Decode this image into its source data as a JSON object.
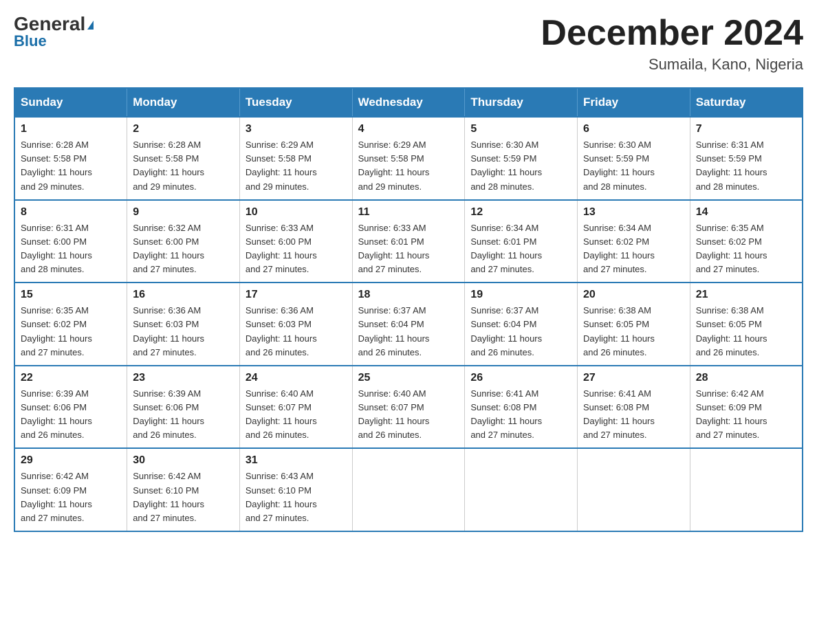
{
  "logo": {
    "part1": "General",
    "part2": "Blue"
  },
  "title": "December 2024",
  "location": "Sumaila, Kano, Nigeria",
  "days_of_week": [
    "Sunday",
    "Monday",
    "Tuesday",
    "Wednesday",
    "Thursday",
    "Friday",
    "Saturday"
  ],
  "weeks": [
    [
      {
        "day": "1",
        "sunrise": "6:28 AM",
        "sunset": "5:58 PM",
        "daylight": "11 hours and 29 minutes."
      },
      {
        "day": "2",
        "sunrise": "6:28 AM",
        "sunset": "5:58 PM",
        "daylight": "11 hours and 29 minutes."
      },
      {
        "day": "3",
        "sunrise": "6:29 AM",
        "sunset": "5:58 PM",
        "daylight": "11 hours and 29 minutes."
      },
      {
        "day": "4",
        "sunrise": "6:29 AM",
        "sunset": "5:58 PM",
        "daylight": "11 hours and 29 minutes."
      },
      {
        "day": "5",
        "sunrise": "6:30 AM",
        "sunset": "5:59 PM",
        "daylight": "11 hours and 28 minutes."
      },
      {
        "day": "6",
        "sunrise": "6:30 AM",
        "sunset": "5:59 PM",
        "daylight": "11 hours and 28 minutes."
      },
      {
        "day": "7",
        "sunrise": "6:31 AM",
        "sunset": "5:59 PM",
        "daylight": "11 hours and 28 minutes."
      }
    ],
    [
      {
        "day": "8",
        "sunrise": "6:31 AM",
        "sunset": "6:00 PM",
        "daylight": "11 hours and 28 minutes."
      },
      {
        "day": "9",
        "sunrise": "6:32 AM",
        "sunset": "6:00 PM",
        "daylight": "11 hours and 27 minutes."
      },
      {
        "day": "10",
        "sunrise": "6:33 AM",
        "sunset": "6:00 PM",
        "daylight": "11 hours and 27 minutes."
      },
      {
        "day": "11",
        "sunrise": "6:33 AM",
        "sunset": "6:01 PM",
        "daylight": "11 hours and 27 minutes."
      },
      {
        "day": "12",
        "sunrise": "6:34 AM",
        "sunset": "6:01 PM",
        "daylight": "11 hours and 27 minutes."
      },
      {
        "day": "13",
        "sunrise": "6:34 AM",
        "sunset": "6:02 PM",
        "daylight": "11 hours and 27 minutes."
      },
      {
        "day": "14",
        "sunrise": "6:35 AM",
        "sunset": "6:02 PM",
        "daylight": "11 hours and 27 minutes."
      }
    ],
    [
      {
        "day": "15",
        "sunrise": "6:35 AM",
        "sunset": "6:02 PM",
        "daylight": "11 hours and 27 minutes."
      },
      {
        "day": "16",
        "sunrise": "6:36 AM",
        "sunset": "6:03 PM",
        "daylight": "11 hours and 27 minutes."
      },
      {
        "day": "17",
        "sunrise": "6:36 AM",
        "sunset": "6:03 PM",
        "daylight": "11 hours and 26 minutes."
      },
      {
        "day": "18",
        "sunrise": "6:37 AM",
        "sunset": "6:04 PM",
        "daylight": "11 hours and 26 minutes."
      },
      {
        "day": "19",
        "sunrise": "6:37 AM",
        "sunset": "6:04 PM",
        "daylight": "11 hours and 26 minutes."
      },
      {
        "day": "20",
        "sunrise": "6:38 AM",
        "sunset": "6:05 PM",
        "daylight": "11 hours and 26 minutes."
      },
      {
        "day": "21",
        "sunrise": "6:38 AM",
        "sunset": "6:05 PM",
        "daylight": "11 hours and 26 minutes."
      }
    ],
    [
      {
        "day": "22",
        "sunrise": "6:39 AM",
        "sunset": "6:06 PM",
        "daylight": "11 hours and 26 minutes."
      },
      {
        "day": "23",
        "sunrise": "6:39 AM",
        "sunset": "6:06 PM",
        "daylight": "11 hours and 26 minutes."
      },
      {
        "day": "24",
        "sunrise": "6:40 AM",
        "sunset": "6:07 PM",
        "daylight": "11 hours and 26 minutes."
      },
      {
        "day": "25",
        "sunrise": "6:40 AM",
        "sunset": "6:07 PM",
        "daylight": "11 hours and 26 minutes."
      },
      {
        "day": "26",
        "sunrise": "6:41 AM",
        "sunset": "6:08 PM",
        "daylight": "11 hours and 27 minutes."
      },
      {
        "day": "27",
        "sunrise": "6:41 AM",
        "sunset": "6:08 PM",
        "daylight": "11 hours and 27 minutes."
      },
      {
        "day": "28",
        "sunrise": "6:42 AM",
        "sunset": "6:09 PM",
        "daylight": "11 hours and 27 minutes."
      }
    ],
    [
      {
        "day": "29",
        "sunrise": "6:42 AM",
        "sunset": "6:09 PM",
        "daylight": "11 hours and 27 minutes."
      },
      {
        "day": "30",
        "sunrise": "6:42 AM",
        "sunset": "6:10 PM",
        "daylight": "11 hours and 27 minutes."
      },
      {
        "day": "31",
        "sunrise": "6:43 AM",
        "sunset": "6:10 PM",
        "daylight": "11 hours and 27 minutes."
      },
      null,
      null,
      null,
      null
    ]
  ],
  "labels": {
    "sunrise": "Sunrise:",
    "sunset": "Sunset:",
    "daylight": "Daylight:"
  }
}
